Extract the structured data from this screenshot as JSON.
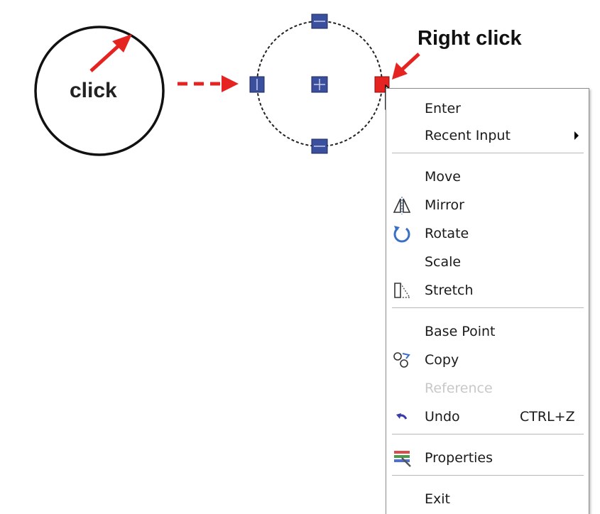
{
  "annotations": {
    "click_label": "click",
    "right_click_label": "Right click"
  },
  "colors": {
    "annotation_red": "#e52421",
    "grip_blue": "#3a4f9e",
    "hot_grip_red": "#e52421"
  },
  "context_menu": {
    "items": [
      {
        "label": "Enter",
        "icon": "",
        "submenu": false
      },
      {
        "label": "Recent Input",
        "icon": "",
        "submenu": true
      },
      {
        "label": "Move",
        "icon": ""
      },
      {
        "label": "Mirror",
        "icon": "mirror-icon"
      },
      {
        "label": "Rotate",
        "icon": "rotate-icon"
      },
      {
        "label": "Scale",
        "icon": ""
      },
      {
        "label": "Stretch",
        "icon": "stretch-icon"
      },
      {
        "label": "Base Point",
        "icon": ""
      },
      {
        "label": "Copy",
        "icon": "copy-icon"
      },
      {
        "label": "Reference",
        "icon": "",
        "disabled": true
      },
      {
        "label": "Undo",
        "icon": "undo-icon",
        "shortcut": "CTRL+Z"
      },
      {
        "label": "Properties",
        "icon": "properties-icon"
      },
      {
        "label": "Exit",
        "icon": ""
      }
    ]
  }
}
